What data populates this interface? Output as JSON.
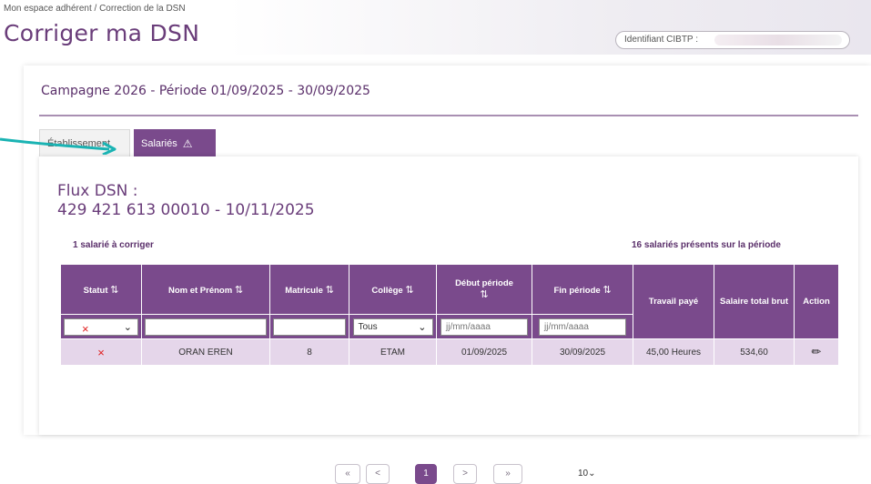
{
  "breadcrumb": "Mon espace adhérent / Correction de la DSN",
  "page_title": "Corriger ma DSN",
  "cibtp_label": "Identifiant CIBTP :",
  "campaign": "Campagne 2026 - Période 01/09/2025 - 30/09/2025",
  "tabs": [
    {
      "label": "Établissement"
    },
    {
      "label": "Salariés",
      "warning": "⚠"
    }
  ],
  "flux": {
    "line1": "Flux DSN :",
    "line2": "429 421 613 00010 - 10/11/2025"
  },
  "count_left": "1 salarié à corriger",
  "count_right": "16 salariés présents sur la période",
  "table": {
    "headers": {
      "statut": "Statut",
      "nom": "Nom et Prénom",
      "matricule": "Matricule",
      "college": "Collège",
      "debut": "Début période",
      "fin": "Fin période",
      "travail": "Travail payé",
      "salaire": "Salaire total brut",
      "action": "Action"
    },
    "sort_icon": "⇅",
    "filters": {
      "statut": "×",
      "college": "Tous",
      "debut_placeholder": "jj/mm/aaaa",
      "fin_placeholder": "jj/mm/aaaa"
    },
    "rows": [
      {
        "statut": "×",
        "nom": "ORAN EREN",
        "matricule": "8",
        "college": "ETAM",
        "debut": "01/09/2025",
        "fin": "30/09/2025",
        "travail": "45,00 Heures",
        "salaire": "534,60"
      }
    ]
  },
  "pagination": {
    "first": "«",
    "prev": "<",
    "current": "1",
    "next": ">",
    "last": "»",
    "page_size": "10"
  },
  "colors": {
    "brand": "#7a4a8c",
    "row": "#e5d6ea",
    "error": "#e02020",
    "arrow": "#1ab3b3"
  }
}
